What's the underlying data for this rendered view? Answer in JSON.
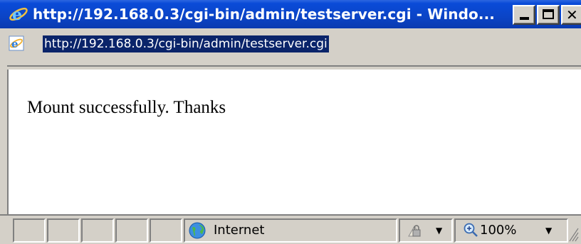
{
  "window": {
    "title": "http://192.168.0.3/cgi-bin/admin/testserver.cgi - Windo..."
  },
  "address_bar": {
    "url": "http://192.168.0.3/cgi-bin/admin/testserver.cgi"
  },
  "content": {
    "message": "Mount successfully. Thanks"
  },
  "status_bar": {
    "zone_label": "Internet",
    "zoom_level": "100%"
  },
  "icons": {
    "title": "ie-logo-icon",
    "address": "ie-page-icon",
    "zone": "globe-icon",
    "protected_mode": "lock-icon",
    "zoom": "magnifier-icon",
    "minimize": "minimize-icon",
    "maximize": "maximize-icon",
    "close": "close-icon"
  },
  "colors": {
    "titlebar": "#0a4bd8",
    "selection": "#0a246a",
    "chrome": "#d4d0c8"
  }
}
